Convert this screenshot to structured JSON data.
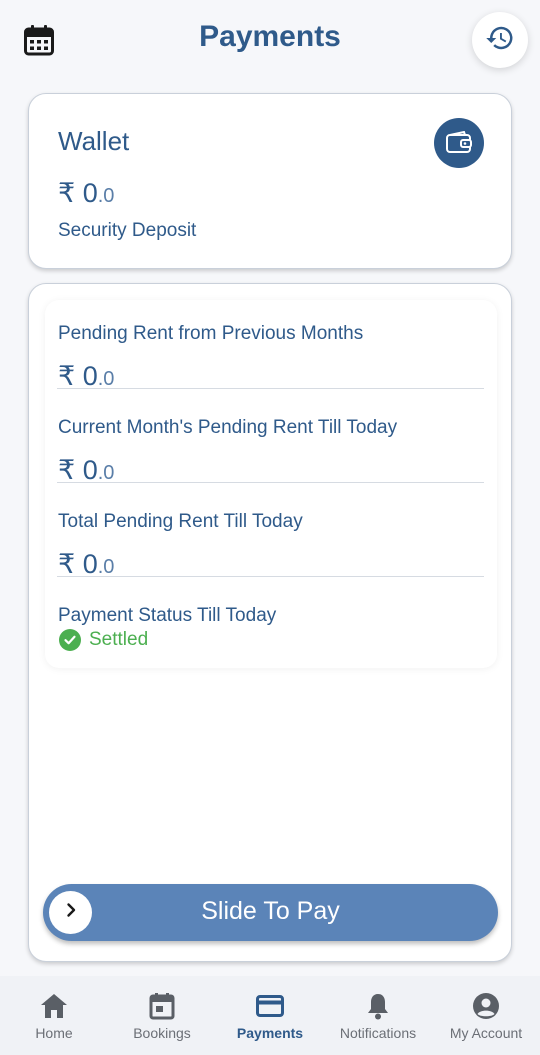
{
  "header": {
    "title": "Payments",
    "calendar_icon": "calendar-icon",
    "history_icon": "history-icon"
  },
  "wallet": {
    "title": "Wallet",
    "currency": "₹",
    "amount_int": "0",
    "amount_dec": ".0",
    "label": "Security Deposit",
    "icon": "wallet-icon"
  },
  "pending": {
    "rows": [
      {
        "label": "Pending Rent from Previous Months",
        "currency": "₹",
        "amount_int": "0",
        "amount_dec": ".0"
      },
      {
        "label": "Current Month's Pending Rent Till Today",
        "currency": "₹",
        "amount_int": "0",
        "amount_dec": ".0"
      },
      {
        "label": "Total Pending Rent Till Today",
        "currency": "₹",
        "amount_int": "0",
        "amount_dec": ".0"
      }
    ],
    "status_label": "Payment Status Till Today",
    "status_value": "Settled",
    "status_color": "#4caf50"
  },
  "slider": {
    "label": "Slide To Pay"
  },
  "bottom_nav": {
    "items": [
      {
        "label": "Home",
        "icon": "home-icon"
      },
      {
        "label": "Bookings",
        "icon": "calendar-icon"
      },
      {
        "label": "Payments",
        "icon": "credit-card-icon",
        "active": true
      },
      {
        "label": "Notifications",
        "icon": "bell-icon"
      },
      {
        "label": "My Account",
        "icon": "account-icon"
      }
    ]
  },
  "colors": {
    "primary": "#2f5a8a",
    "slider": "#5b84b8",
    "success": "#4caf50"
  }
}
